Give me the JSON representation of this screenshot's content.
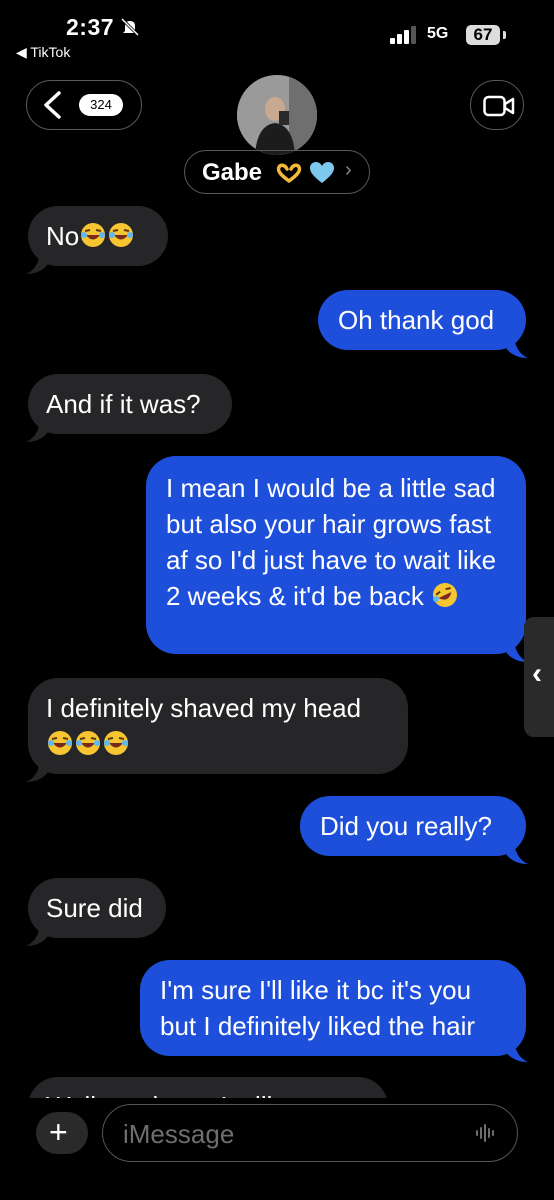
{
  "status": {
    "time": "2:37",
    "back_app": "◀ TikTok",
    "network": "5G",
    "battery": "67"
  },
  "header": {
    "unread_count": "324",
    "contact_name": "Gabe"
  },
  "messages": [
    {
      "side": "in",
      "text": "No",
      "emoji_after": 2
    },
    {
      "side": "out",
      "text": "Oh thank god"
    },
    {
      "side": "in",
      "text": "And if it was?"
    },
    {
      "side": "out",
      "text": "I mean I would be a little sad but also your hair grows fast af so I'd just have to wait like 2 weeks & it'd be back"
    },
    {
      "side": "in",
      "text": "I definitely shaved my head"
    },
    {
      "side": "out",
      "text": "Did you really?"
    },
    {
      "side": "in",
      "text": "Sure did"
    },
    {
      "side": "out",
      "text": "I'm sure I'll like it bc it's you but I definitely liked the hair"
    },
    {
      "side": "in",
      "text": "Well you know I still got"
    }
  ],
  "input": {
    "placeholder": "iMessage"
  },
  "colors": {
    "incoming_bubble": "#262628",
    "outgoing_bubble": "#1e4fdb",
    "background": "#000000"
  },
  "icons": [
    "bell-off-icon",
    "signal-icon",
    "battery-icon",
    "back-chevron-icon",
    "video-call-icon",
    "heart-hands-emoji",
    "blue-heart-emoji",
    "laughing-emoji",
    "rofl-emoji",
    "plus-icon",
    "audio-waveform-icon"
  ]
}
